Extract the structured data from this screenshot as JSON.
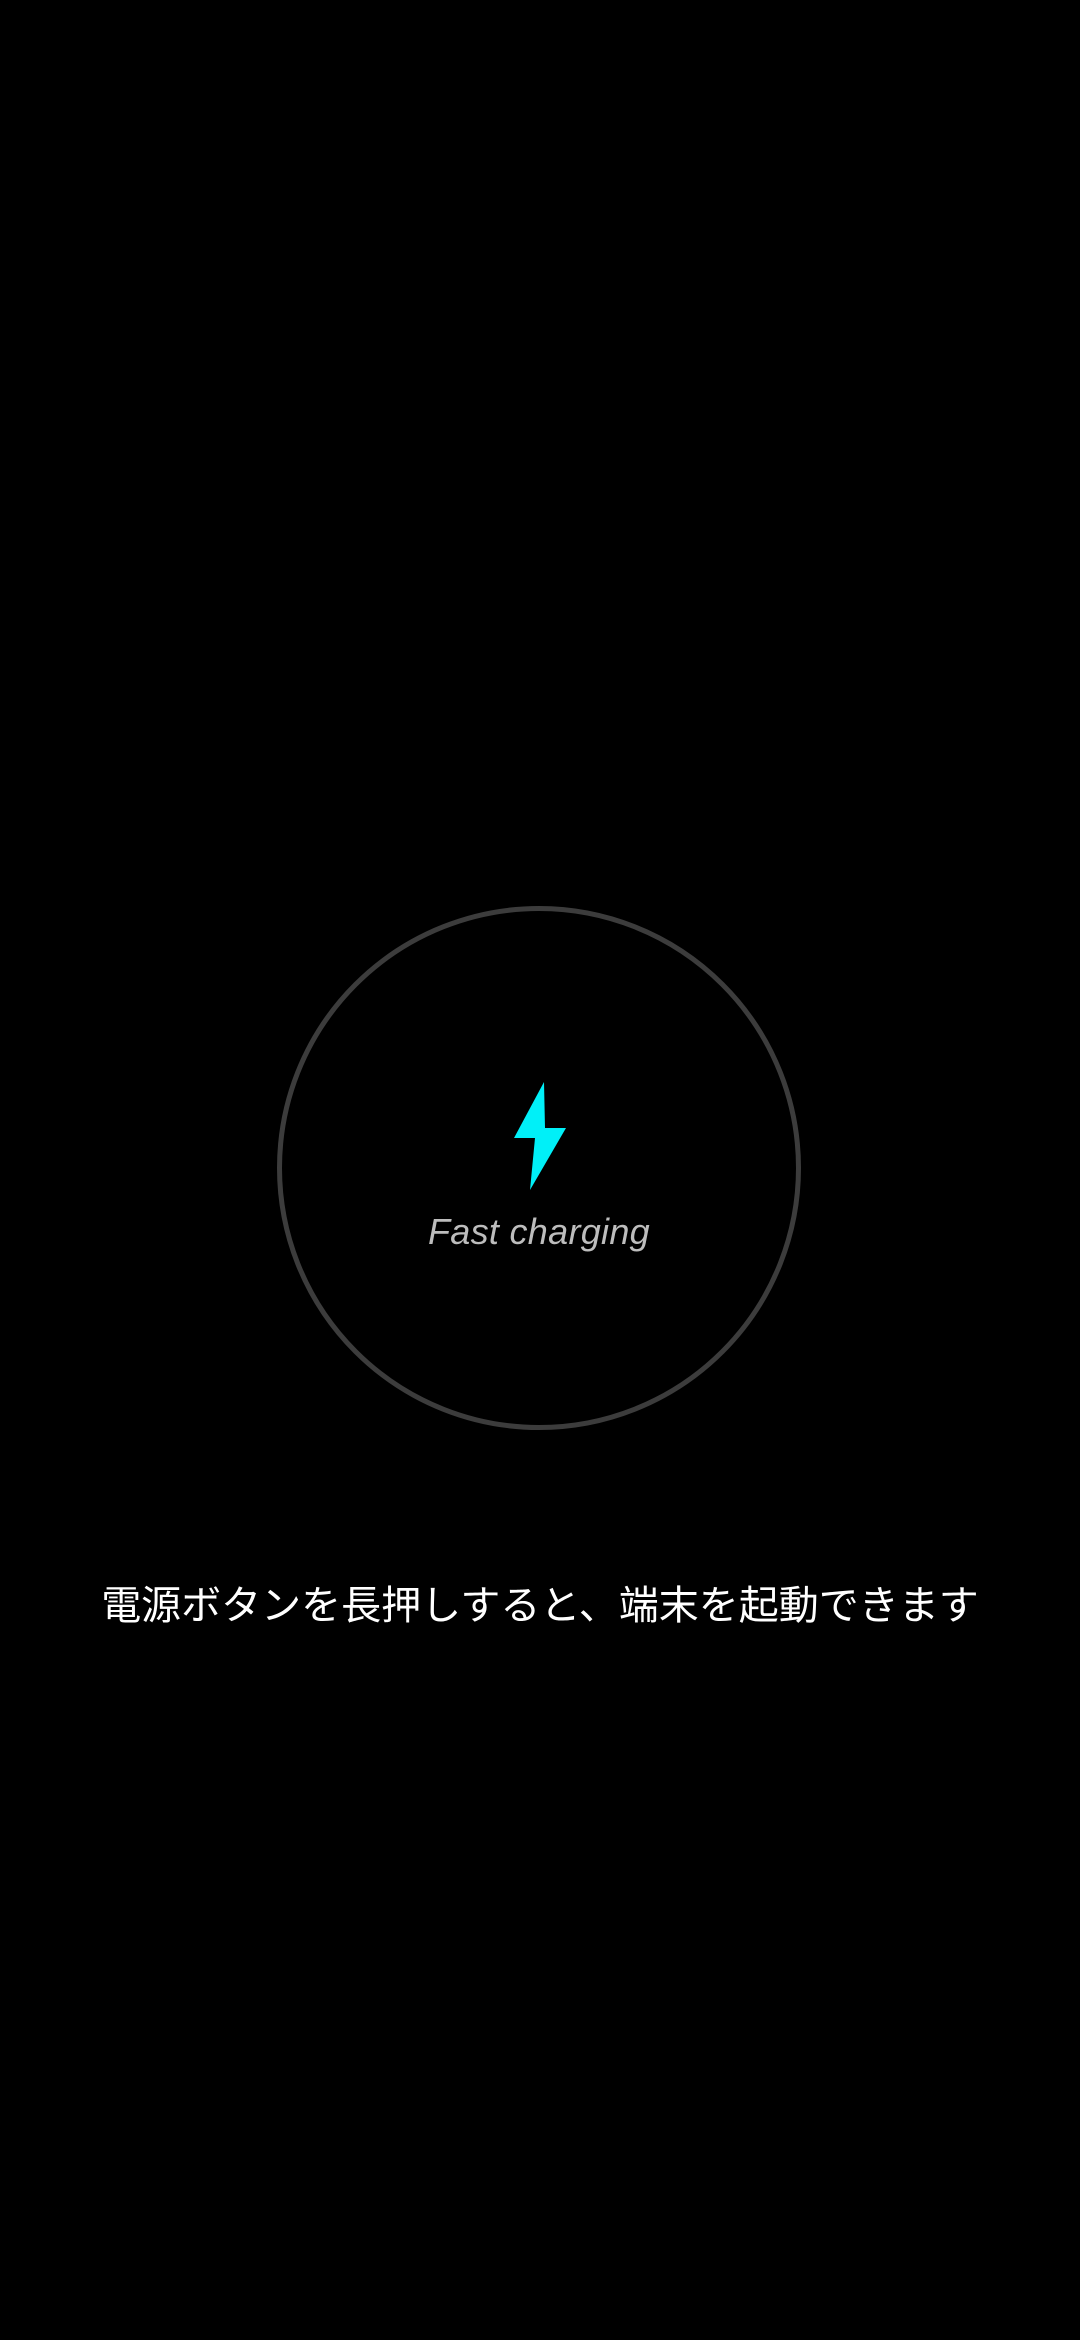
{
  "charging": {
    "status_label": "Fast charging",
    "icon": "lightning-bolt-icon",
    "accent_color": "#00f0f8",
    "ring_color": "#3c3c3c"
  },
  "hint": {
    "text": "電源ボタンを長押しすると、端末を起動できます"
  }
}
